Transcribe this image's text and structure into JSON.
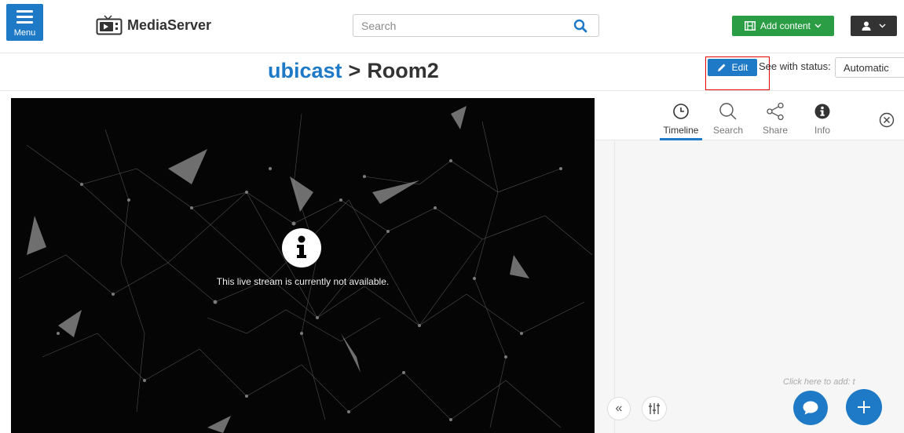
{
  "header": {
    "menu_label": "Menu",
    "app_name": "MediaServer",
    "search": {
      "placeholder": "Search",
      "value": ""
    },
    "add_content_label": "Add content"
  },
  "title_bar": {
    "breadcrumb": {
      "parent": "ubicast",
      "separator": ">",
      "current": "Room2"
    },
    "edit_label": "Edit",
    "status_label": "See with status:",
    "status_value": "Automatic"
  },
  "player": {
    "message": "This live stream is currently not available."
  },
  "side_panel": {
    "tabs": [
      {
        "label": "Timeline",
        "icon": "clock-icon",
        "active": true
      },
      {
        "label": "Search",
        "icon": "search-icon",
        "active": false
      },
      {
        "label": "Share",
        "icon": "share-icon",
        "active": false
      },
      {
        "label": "Info",
        "icon": "info-icon",
        "active": false
      }
    ],
    "click_to_add": "Click here to add: t",
    "collapse_glyph": "«"
  },
  "colors": {
    "primary": "#1e79c6",
    "success": "#2a9d45",
    "dark": "#333333",
    "highlight": "#e60000"
  }
}
